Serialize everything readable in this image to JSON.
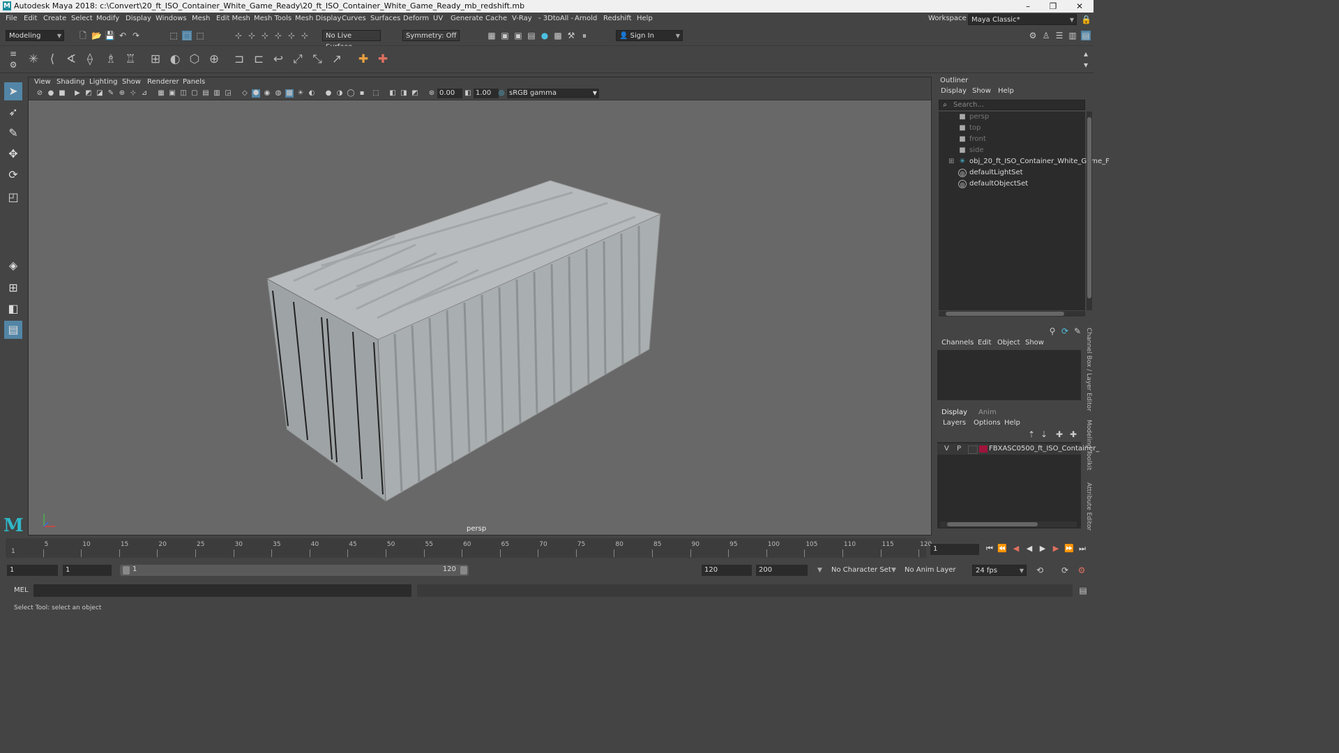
{
  "app": {
    "title": "Autodesk Maya 2018: c:\\Convert\\20_ft_ISO_Container_White_Game_Ready\\20_ft_ISO_Container_White_Game_Ready_mb_redshift.mb",
    "logo": "M",
    "window_controls": [
      "–",
      "❐",
      "✕"
    ]
  },
  "menubar": [
    "File",
    "Edit",
    "Create",
    "Select",
    "Modify",
    "Display",
    "Windows",
    "Mesh",
    "Edit Mesh",
    "Mesh Tools",
    "Mesh Display",
    "Curves",
    "Surfaces",
    "Deform",
    "UV",
    "Generate",
    "Cache",
    "V-Ray",
    "- 3DtoAll -",
    "Arnold",
    "Redshift",
    "Help"
  ],
  "workspace": {
    "label": "Workspace :",
    "value": "Maya Classic*"
  },
  "statusline": {
    "mode": "Modeling",
    "live_surface": "No Live Surface",
    "symmetry": "Symmetry: Off",
    "sign_in": "Sign In"
  },
  "viewport": {
    "menu": [
      "View",
      "Shading",
      "Lighting",
      "Show",
      "Renderer",
      "Panels"
    ],
    "exposure": "0.00",
    "gamma": "1.00",
    "color_space": "sRGB gamma",
    "camera_label": "persp"
  },
  "outliner": {
    "title": "Outliner",
    "menu": [
      "Display",
      "Show",
      "Help"
    ],
    "search_placeholder": "Search...",
    "items": [
      {
        "label": "persp",
        "kind": "camera"
      },
      {
        "label": "top",
        "kind": "camera"
      },
      {
        "label": "front",
        "kind": "camera"
      },
      {
        "label": "side",
        "kind": "camera"
      },
      {
        "label": "obj_20_ft_ISO_Container_White_Game_F",
        "kind": "mesh"
      },
      {
        "label": "defaultLightSet",
        "kind": "set"
      },
      {
        "label": "defaultObjectSet",
        "kind": "set"
      }
    ]
  },
  "channelbox": {
    "menu": [
      "Channels",
      "Edit",
      "Object",
      "Show"
    ]
  },
  "layers": {
    "tabs": [
      "Display",
      "Anim"
    ],
    "menu": [
      "Layers",
      "Options",
      "Help"
    ],
    "layer": {
      "v": "V",
      "p": "P",
      "name": "FBXASC0500_ft_ISO_Container_",
      "color": "#a0143c"
    }
  },
  "side_tabs": [
    "Channel Box / Layer Editor",
    "Modeling Toolkit",
    "Attribute Editor"
  ],
  "timeslider": {
    "ticks": [
      5,
      10,
      15,
      20,
      25,
      30,
      35,
      40,
      45,
      50,
      55,
      60,
      65,
      70,
      75,
      80,
      85,
      90,
      95,
      100,
      105,
      110,
      115,
      120
    ],
    "first_tick": "1",
    "current_frame": "1"
  },
  "rangeslider": {
    "start": "1",
    "anim_start": "1",
    "range_start": "1",
    "range_end": "120",
    "end": "120",
    "anim_end": "200",
    "character_set": "No Character Set",
    "anim_layer": "No Anim Layer",
    "fps": "24 fps"
  },
  "cmdline": {
    "label": "MEL"
  },
  "status": "Select Tool: select an object"
}
